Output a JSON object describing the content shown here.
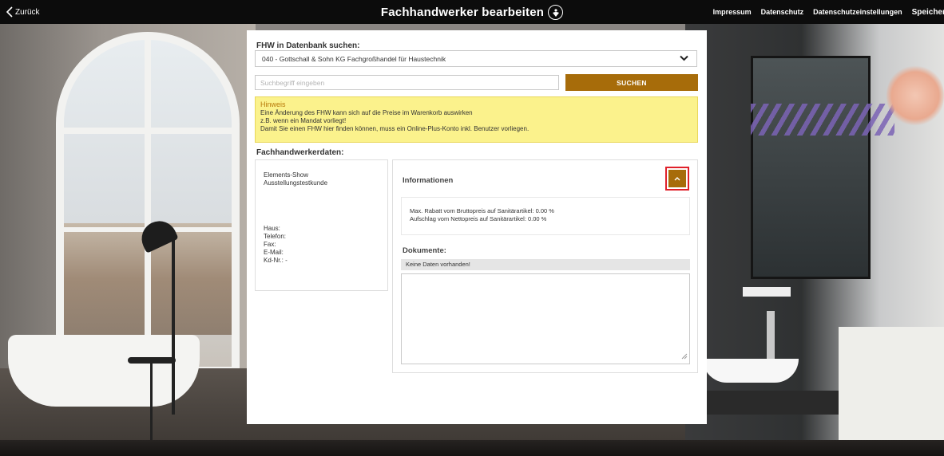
{
  "topbar": {
    "back_label": "Zurück",
    "title": "Fachhandwerker bearbeiten",
    "links": [
      "Impressum",
      "Datenschutz",
      "Datenschutzeinstellungen"
    ],
    "save_label": "Speichern"
  },
  "search_section": {
    "db_label": "FHW in Datenbank suchen:",
    "selected_option": "040 - Gottschall & Sohn KG Fachgroßhandel für Haustechnik",
    "search_placeholder": "Suchbegriff eingeben",
    "search_button": "SUCHEN"
  },
  "hint": {
    "title": "Hinweis",
    "lines": [
      "Eine Änderung des FHW kann sich auf die Preise im Warenkorb auswirken",
      "z.B. wenn ein Mandat vorliegt!",
      "Damit Sie einen FHW hier finden können, muss ein Online-Plus-Konto inkl. Benutzer vorliegen."
    ]
  },
  "fhw": {
    "section_label": "Fachhandwerkerdaten:",
    "name_lines": [
      "Elements-Show",
      "Ausstellungstestkunde"
    ],
    "contact_lines": [
      "Haus:",
      "Telefon:",
      "Fax:",
      "E-Mail:",
      "Kd-Nr.: -"
    ]
  },
  "info": {
    "title": "Informationen",
    "rates": [
      "Max. Rabatt vom Bruttopreis auf Sanitärartikel: 0.00 %",
      "Aufschlag vom Nettopreis auf Sanitärartikel: 0.00 %"
    ],
    "docs_label": "Dokumente:",
    "docs_empty": "Keine Daten vorhanden!"
  },
  "colors": {
    "accent": "#a76c0a",
    "highlight_border": "#e0202a",
    "hint_bg": "#fbf28c",
    "topbar_bg": "#0c0c0c"
  },
  "icons": {
    "back": "chevron-left-icon",
    "logo": "brand-logo-icon",
    "dropdown": "chevron-down-icon",
    "collapse": "chevron-up-icon",
    "resize": "resize-grip-icon"
  }
}
